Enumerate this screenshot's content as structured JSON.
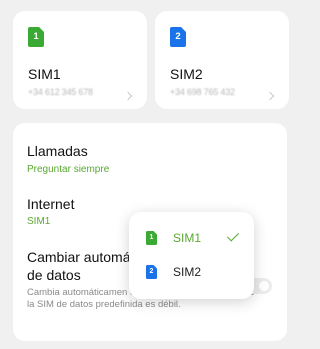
{
  "sims": [
    {
      "slot": "1",
      "title": "SIM1",
      "number": "+34 612 345 678",
      "color": "#3aaa35"
    },
    {
      "slot": "2",
      "title": "SIM2",
      "number": "+34 698 765 432",
      "color": "#1a73e8"
    }
  ],
  "settings": {
    "calls": {
      "title": "Llamadas",
      "value": "Preguntar siempre"
    },
    "internet": {
      "title": "Internet",
      "value": "SIM1"
    },
    "switch_data": {
      "title": "Cambiar automát de datos",
      "description": "Cambia automáticamen cuando la conexión de red de la SIM de datos predefinida es débil.",
      "enabled": false
    }
  },
  "popup": {
    "options": [
      {
        "slot": "1",
        "label": "SIM1",
        "selected": true,
        "color": "#3aaa35"
      },
      {
        "slot": "2",
        "label": "SIM2",
        "selected": false,
        "color": "#1a73e8"
      }
    ]
  },
  "colors": {
    "accent": "#5aa832",
    "background": "#f0f0f0"
  }
}
